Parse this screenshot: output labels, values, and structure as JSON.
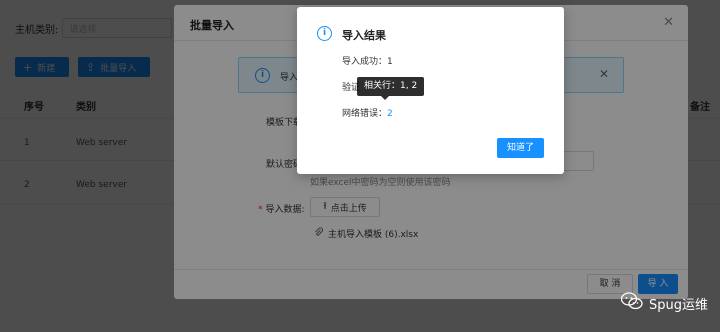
{
  "filter": {
    "label": "主机类别:",
    "placeholder": "请选择"
  },
  "toolbar": {
    "new_label": "新建",
    "batch_label": "批量导入"
  },
  "table": {
    "headers": [
      "序号",
      "类别",
      "备注"
    ],
    "rows": [
      {
        "index": "1",
        "category": "Web server"
      },
      {
        "index": "2",
        "category": "Web server"
      }
    ]
  },
  "modal": {
    "title": "批量导入",
    "alert_text": "导入",
    "template_label": "模板下载",
    "password_label": "默认密码",
    "hint": "如果excel中密码为空则使用该密码",
    "data_label": "导入数据:",
    "upload_label": "点击上传",
    "file_name": "主机导入模板 (6).xlsx",
    "cancel_label": "取 消",
    "import_label": "导 入"
  },
  "result": {
    "title": "导入结果",
    "success_label": "导入成功：",
    "success_count": "1",
    "verify_label": "验证",
    "tooltip": "相关行：1, 2",
    "network_label": "网络错误：",
    "network_count": "2",
    "ok_label": "知道了"
  },
  "watermark": {
    "text": "Spug运维"
  },
  "colors": {
    "primary": "#1890ff",
    "alert_bg": "#e6f7ff",
    "mask": "rgba(0,0,0,0.45)"
  }
}
